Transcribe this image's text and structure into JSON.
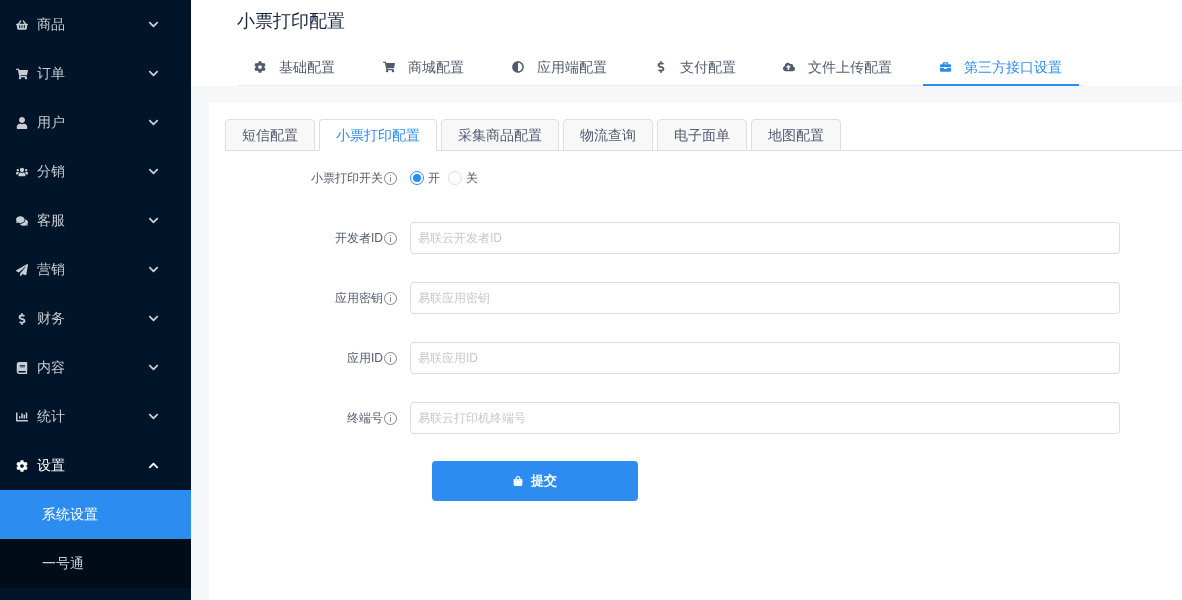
{
  "sidebar": {
    "items": [
      {
        "label": "商品",
        "expanded": false
      },
      {
        "label": "订单",
        "expanded": false
      },
      {
        "label": "用户",
        "expanded": false
      },
      {
        "label": "分销",
        "expanded": false
      },
      {
        "label": "客服",
        "expanded": false
      },
      {
        "label": "营销",
        "expanded": false
      },
      {
        "label": "财务",
        "expanded": false
      },
      {
        "label": "内容",
        "expanded": false
      },
      {
        "label": "统计",
        "expanded": false
      },
      {
        "label": "设置",
        "expanded": true,
        "children": [
          {
            "label": "系统设置",
            "selected": true
          },
          {
            "label": "一号通",
            "selected": false
          }
        ]
      }
    ]
  },
  "page_title": "小票打印配置",
  "tabs": [
    {
      "label": "基础配置",
      "selected": false
    },
    {
      "label": "商城配置",
      "selected": false
    },
    {
      "label": "应用端配置",
      "selected": false
    },
    {
      "label": "支付配置",
      "selected": false
    },
    {
      "label": "文件上传配置",
      "selected": false
    },
    {
      "label": "第三方接口设置",
      "selected": true
    }
  ],
  "sub_tabs": [
    {
      "label": "短信配置",
      "selected": false
    },
    {
      "label": "小票打印配置",
      "selected": true
    },
    {
      "label": "采集商品配置",
      "selected": false
    },
    {
      "label": "物流查询",
      "selected": false
    },
    {
      "label": "电子面单",
      "selected": false
    },
    {
      "label": "地图配置",
      "selected": false
    }
  ],
  "form": {
    "fields": [
      {
        "kind": "radio",
        "label": "小票打印开关",
        "options": [
          {
            "label": "开",
            "selected": true
          },
          {
            "label": "关",
            "selected": false
          }
        ]
      },
      {
        "kind": "input",
        "label": "开发者ID",
        "placeholder": "易联云开发者ID"
      },
      {
        "kind": "input",
        "label": "应用密钥",
        "placeholder": "易联应用密钥"
      },
      {
        "kind": "input",
        "label": "应用ID",
        "placeholder": "易联应用ID"
      },
      {
        "kind": "input",
        "label": "终端号",
        "placeholder": "易联云打印机终端号"
      }
    ],
    "submit": "提交"
  }
}
